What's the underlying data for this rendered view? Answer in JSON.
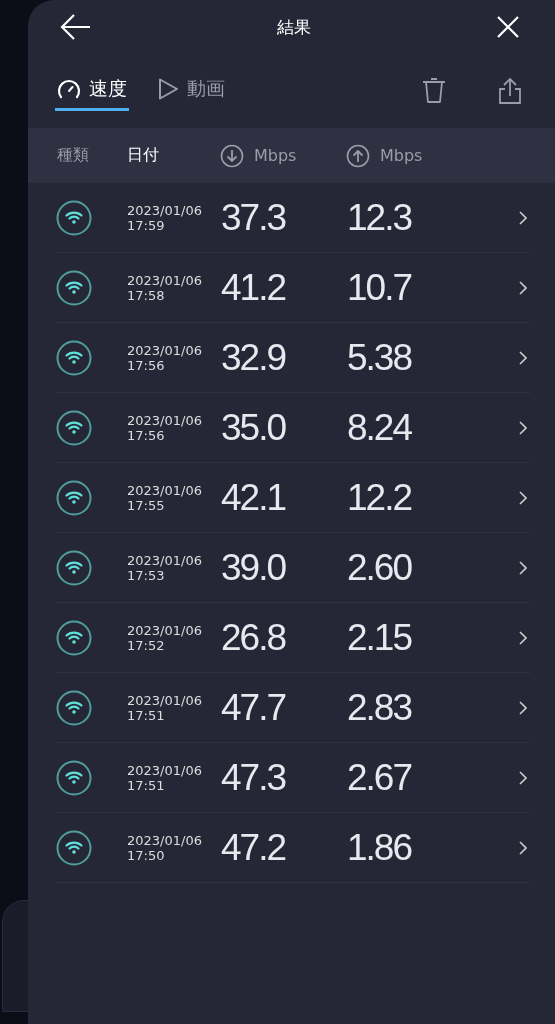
{
  "header": {
    "title": "結果"
  },
  "tabs": [
    {
      "label": "速度",
      "kind": "speed",
      "selected": true
    },
    {
      "label": "動画",
      "kind": "video",
      "selected": false
    }
  ],
  "columns": [
    {
      "label": "種類",
      "kind": "text",
      "selected": false
    },
    {
      "label": "日付",
      "kind": "text",
      "selected": true
    },
    {
      "label": "Mbps",
      "kind": "download",
      "selected": false
    },
    {
      "label": "Mbps",
      "kind": "upload",
      "selected": false
    }
  ],
  "rows": [
    {
      "date": "2023/01/06",
      "time": "17:59",
      "download": "37.3",
      "upload": "12.3"
    },
    {
      "date": "2023/01/06",
      "time": "17:58",
      "download": "41.2",
      "upload": "10.7"
    },
    {
      "date": "2023/01/06",
      "time": "17:56",
      "download": "32.9",
      "upload": "5.38"
    },
    {
      "date": "2023/01/06",
      "time": "17:56",
      "download": "35.0",
      "upload": "8.24"
    },
    {
      "date": "2023/01/06",
      "time": "17:55",
      "download": "42.1",
      "upload": "12.2"
    },
    {
      "date": "2023/01/06",
      "time": "17:53",
      "download": "39.0",
      "upload": "2.60"
    },
    {
      "date": "2023/01/06",
      "time": "17:52",
      "download": "26.8",
      "upload": "2.15"
    },
    {
      "date": "2023/01/06",
      "time": "17:51",
      "download": "47.7",
      "upload": "2.83"
    },
    {
      "date": "2023/01/06",
      "time": "17:51",
      "download": "47.3",
      "upload": "2.67"
    },
    {
      "date": "2023/01/06",
      "time": "17:50",
      "download": "47.2",
      "upload": "1.86"
    }
  ]
}
